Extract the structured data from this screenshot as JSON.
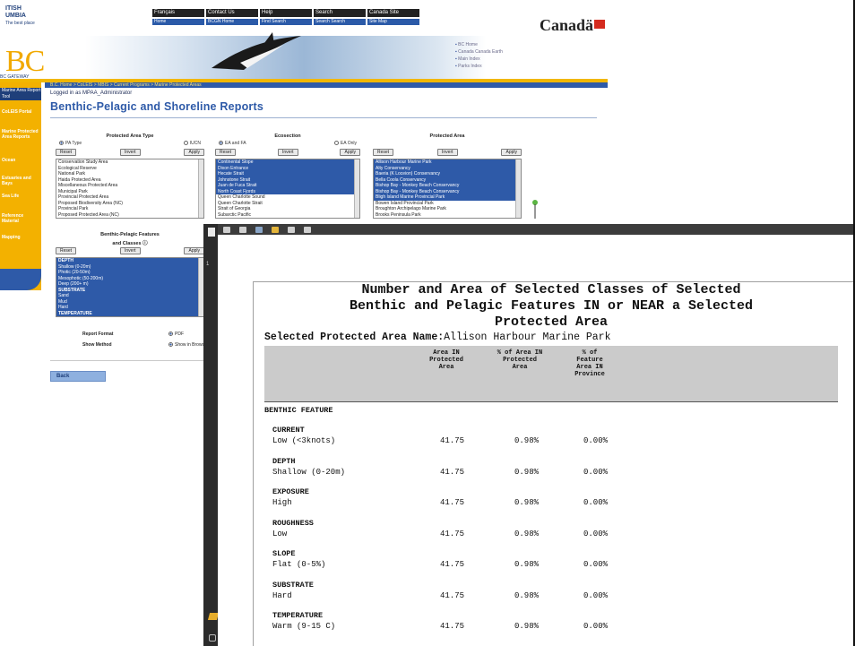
{
  "header": {
    "gov_wordmark_lines": [
      "ITISH",
      "UMBIA",
      "The best place"
    ],
    "federal_nav": [
      "Français",
      "Contact Us",
      "Help",
      "Search",
      "Canada Site"
    ],
    "federal_nav2": [
      "Home",
      "BCGN Home",
      "Find Search",
      "Search Search",
      "Site Map"
    ],
    "canada_wordmark": "Canadä",
    "bc_logo": "BC",
    "bc_logo_sub": "BC GATEWAY",
    "quick_links": [
      "BC Home",
      "Canada Canada Earth",
      "Main Index",
      "Parks Index"
    ],
    "breadcrumb": "B.C. Home > CoLEIS > MBIS > Current Programs > Marine Protected Areas"
  },
  "left_nav": {
    "header": "Marine Area Report Tool",
    "items": [
      "CoLEIS Portal",
      "Marine Protected Area Reports",
      "Ocean",
      "Estuaries and Bays",
      "Sea Life",
      "Reference Material",
      "Mapping"
    ]
  },
  "main": {
    "login": "Logged in as MPAA_Administrator",
    "title": "Benthic-Pelagic and Shoreline Reports"
  },
  "panels": {
    "pa_type": {
      "heading": "Protected Area Type",
      "radio1": "PA Type",
      "radio2": "IUCN",
      "buttons": [
        "Reset",
        "Invert",
        "Apply"
      ],
      "options": [
        {
          "label": "Conservation Study Area",
          "sel": false
        },
        {
          "label": "Ecological Reserve",
          "sel": false
        },
        {
          "label": "National Park",
          "sel": false
        },
        {
          "label": "Haida Protected Area",
          "sel": false
        },
        {
          "label": "Miscellaneous Protected Area",
          "sel": false
        },
        {
          "label": "Municipal Park",
          "sel": false
        },
        {
          "label": "Provincial Protected Area",
          "sel": false
        },
        {
          "label": "Proposed Biodiversity Area (NC)",
          "sel": false
        },
        {
          "label": "Provincial Park",
          "sel": false
        },
        {
          "label": "Proposed Protected Area (NC)",
          "sel": false
        }
      ]
    },
    "ecosection": {
      "heading": "Ecosection",
      "radio1": "EA and FA",
      "radio2": "EA Only",
      "buttons": [
        "Reset",
        "Invert",
        "Apply"
      ],
      "options": [
        {
          "label": "Continental Slope",
          "sel": true
        },
        {
          "label": "Dixon Entrance",
          "sel": true
        },
        {
          "label": "Hecate Strait",
          "sel": true
        },
        {
          "label": "Johnstone Strait",
          "sel": true
        },
        {
          "label": "Juan de Fuca Strait",
          "sel": true
        },
        {
          "label": "North Coast Fjords",
          "sel": true
        },
        {
          "label": "Queen Charlotte Sound",
          "sel": false
        },
        {
          "label": "Queen Charlotte Strait",
          "sel": false
        },
        {
          "label": "Strait of Georgia",
          "sel": false
        },
        {
          "label": "Subarctic Pacific",
          "sel": false
        }
      ]
    },
    "protected_area": {
      "heading": "Protected Area",
      "buttons": [
        "Reset",
        "Invert",
        "Apply"
      ],
      "options": [
        {
          "label": "Allison Harbour Marine Park",
          "sel": true
        },
        {
          "label": "Alty Conservancy",
          "sel": true
        },
        {
          "label": "Baeria (K Loceion) Conservancy",
          "sel": true
        },
        {
          "label": "Bella Coola Conservancy",
          "sel": true
        },
        {
          "label": "Bishop Bay - Monkey Beach Conservancy",
          "sel": true
        },
        {
          "label": "Bishop Bay - Monkey Beach Conservancy",
          "sel": true
        },
        {
          "label": "Bligh Island Marine Provincial Park",
          "sel": true
        },
        {
          "label": "Bowen Island Provincial Park",
          "sel": false
        },
        {
          "label": "Broughton Archipelago Marine Park",
          "sel": false
        },
        {
          "label": "Brooks Peninsula Park",
          "sel": false
        }
      ]
    },
    "features": {
      "heading_line1": "Benthic-Pelagic Features",
      "heading_line2": "and Classes",
      "buttons": [
        "Reset",
        "Invert",
        "Apply"
      ],
      "options": [
        {
          "label": "DEPTH",
          "kind": "grp"
        },
        {
          "label": "Shallow (0-20m)",
          "kind": "sel"
        },
        {
          "label": "Photic (20-50m)",
          "kind": "sel"
        },
        {
          "label": "Mesophotic (50-200m)",
          "kind": "sel"
        },
        {
          "label": "Deep (200+ m)",
          "kind": "sel"
        },
        {
          "label": "SUBSTRATE",
          "kind": "grp"
        },
        {
          "label": "Sand",
          "kind": "sel"
        },
        {
          "label": "Mud",
          "kind": "sel"
        },
        {
          "label": "Hard",
          "kind": "sel"
        },
        {
          "label": "TEMPERATURE",
          "kind": "grp"
        }
      ]
    },
    "report_format_label": "Report Format",
    "report_format_value": "PDF",
    "show_method_label": "Show Method",
    "show_method_value": "Show in Browser",
    "back_button": "Back"
  },
  "viewer": {
    "page_number": "1",
    "toolbar_icons": [
      "save-icon",
      "print-icon",
      "email-icon",
      "highlight-icon",
      "page-up-icon",
      "page-down-icon"
    ]
  },
  "report": {
    "title_lines": [
      "Number and Area of Selected Classes of Selected",
      "Benthic and Pelagic Features IN or NEAR a Selected",
      "Protected Area"
    ],
    "selected_label": "Selected Protected Area Name:",
    "selected_value": "Allison Harbour Marine Park",
    "columns": [
      [
        "Area IN",
        "Protected",
        "Area"
      ],
      [
        "% of Area IN",
        "Protected",
        "Area"
      ],
      [
        "% of",
        "Feature",
        "Area IN",
        "Province"
      ]
    ],
    "section": "BENTHIC FEATURE",
    "groups": [
      {
        "name": "CURRENT",
        "cls": "Low (<3knots)",
        "area": "41.75",
        "pct_pa": "0.98%",
        "pct_prov": "0.00%"
      },
      {
        "name": "DEPTH",
        "cls": "Shallow (0-20m)",
        "area": "41.75",
        "pct_pa": "0.98%",
        "pct_prov": "0.00%"
      },
      {
        "name": "EXPOSURE",
        "cls": "High",
        "area": "41.75",
        "pct_pa": "0.98%",
        "pct_prov": "0.00%"
      },
      {
        "name": "ROUGHNESS",
        "cls": "Low",
        "area": "41.75",
        "pct_pa": "0.98%",
        "pct_prov": "0.00%"
      },
      {
        "name": "SLOPE",
        "cls": "Flat (0-5%)",
        "area": "41.75",
        "pct_pa": "0.98%",
        "pct_prov": "0.00%"
      },
      {
        "name": "SUBSTRATE",
        "cls": "Hard",
        "area": "41.75",
        "pct_pa": "0.98%",
        "pct_prov": "0.00%"
      },
      {
        "name": "TEMPERATURE",
        "cls": "Warm (9-15 C)",
        "area": "41.75",
        "pct_pa": "0.98%",
        "pct_prov": "0.00%"
      }
    ]
  },
  "colors": {
    "gov_blue": "#2e5aa8",
    "gov_gold": "#f1b700",
    "viewer_dark": "#1e1e1e",
    "header_grey": "#cbcbcb"
  }
}
